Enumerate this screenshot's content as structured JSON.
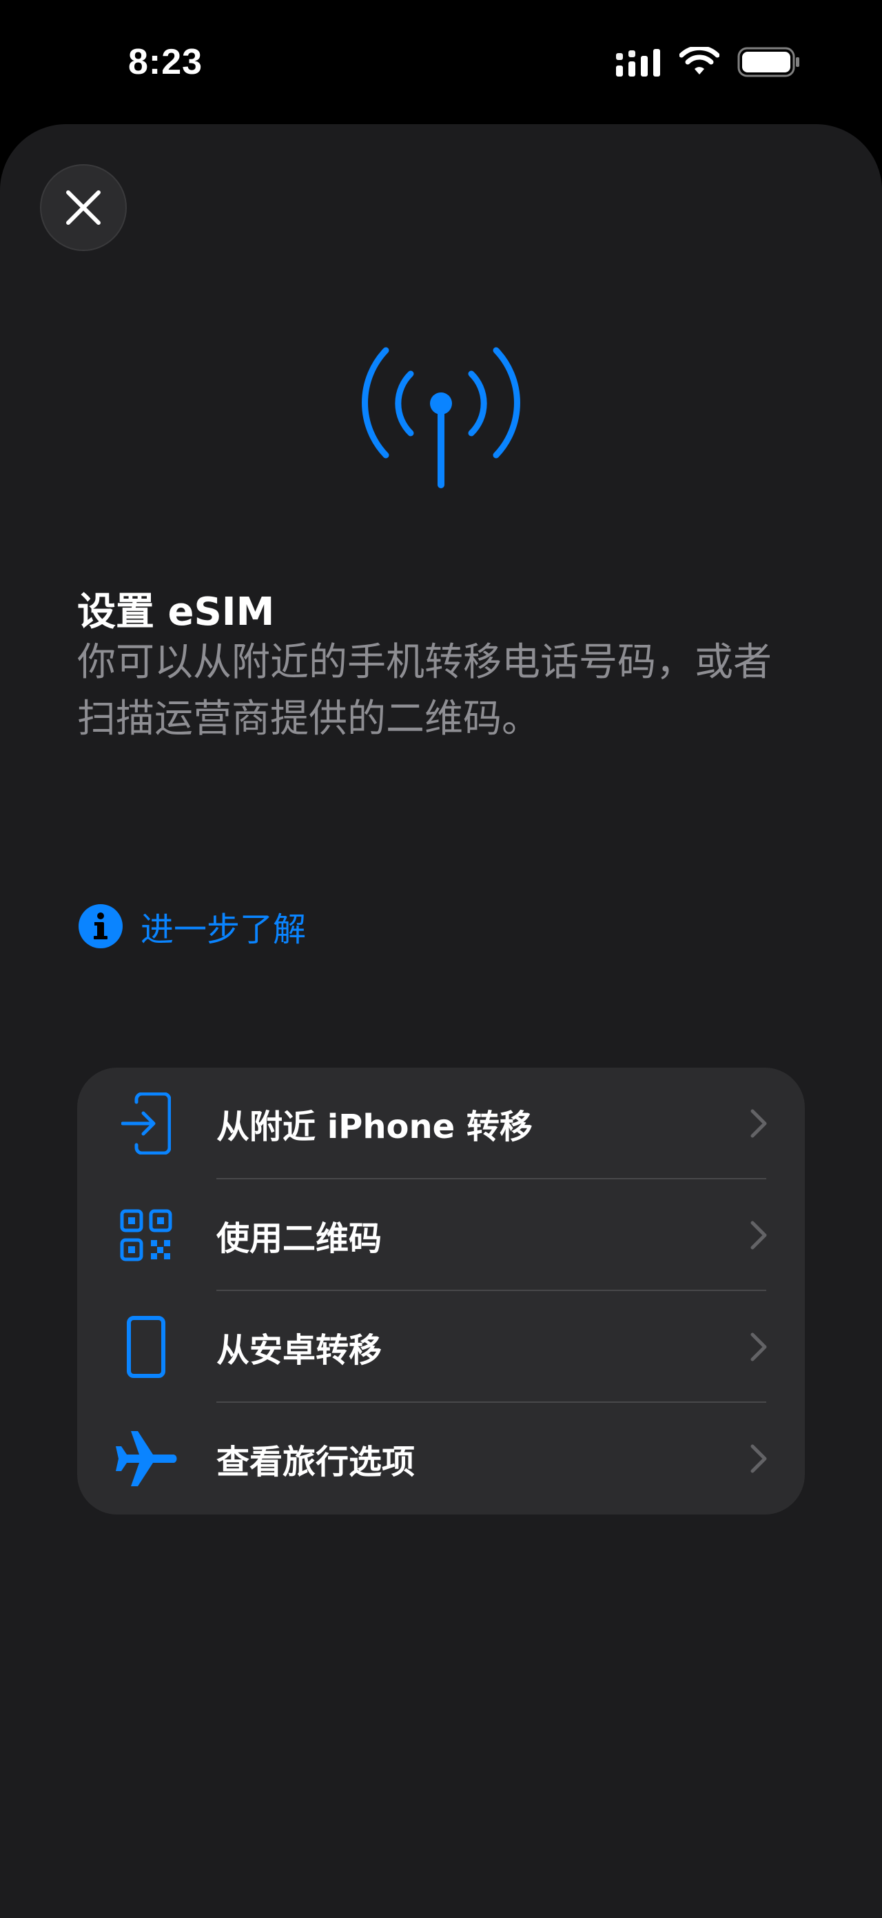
{
  "status_bar": {
    "time": "8:23"
  },
  "colors": {
    "accent": "#0a84ff",
    "sheet_background": "#1c1c1e",
    "list_background": "#2c2c2e",
    "secondary_text": "#8e8e93"
  },
  "sheet": {
    "close_icon": "close-icon",
    "hero_icon": "antenna-radiowaves-icon",
    "title": "设置 eSIM",
    "subtitle": "你可以从附近的手机转移电话号码，或者扫描运营商提供的二维码。",
    "learn_more": {
      "icon": "info-circle-icon",
      "label": "进一步了解"
    },
    "options": [
      {
        "icon": "transfer-in-icon",
        "label": "从附近 iPhone 转移"
      },
      {
        "icon": "qr-code-icon",
        "label": "使用二维码"
      },
      {
        "icon": "phone-icon",
        "label": "从安卓转移"
      },
      {
        "icon": "airplane-icon",
        "label": "查看旅行选项"
      }
    ]
  }
}
